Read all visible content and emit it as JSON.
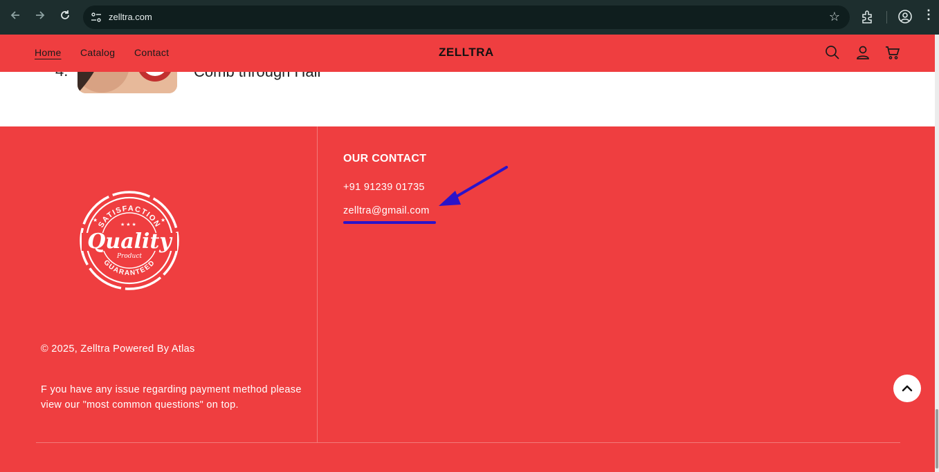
{
  "browser": {
    "url": "zelltra.com",
    "back_icon": "arrow-left-icon",
    "forward_icon": "arrow-right-icon",
    "reload_icon": "reload-icon",
    "bookmark_icon": "star-icon",
    "extensions_icon": "puzzle-icon",
    "profile_icon": "profile-icon",
    "menu_icon": "kebab-menu-icon"
  },
  "header": {
    "nav": [
      "Home",
      "Catalog",
      "Contact"
    ],
    "active_nav": "Home",
    "logo": "ZELLTRA",
    "icons": [
      "search-icon",
      "account-icon",
      "cart-icon"
    ]
  },
  "content": {
    "step_number": "4.",
    "step_text": "Comb through Hair"
  },
  "footer": {
    "badge": {
      "top_text": "SATISFACTION",
      "main_text": "Quality",
      "sub_text": "Product",
      "bottom_text": "GUARANTEED"
    },
    "copyright": "© 2025, Zelltra Powered By Atlas",
    "notice": "F you have any issue regarding payment method please view our \"most common questions\" on top.",
    "contact": {
      "heading": "OUR CONTACT",
      "phone": "+91 91239 01735",
      "email": "zelltra@gmail.com"
    }
  },
  "colors": {
    "brand_red": "#ef3e40",
    "annotation": "#2b13c9",
    "chrome_bg": "#1d2e2e"
  }
}
